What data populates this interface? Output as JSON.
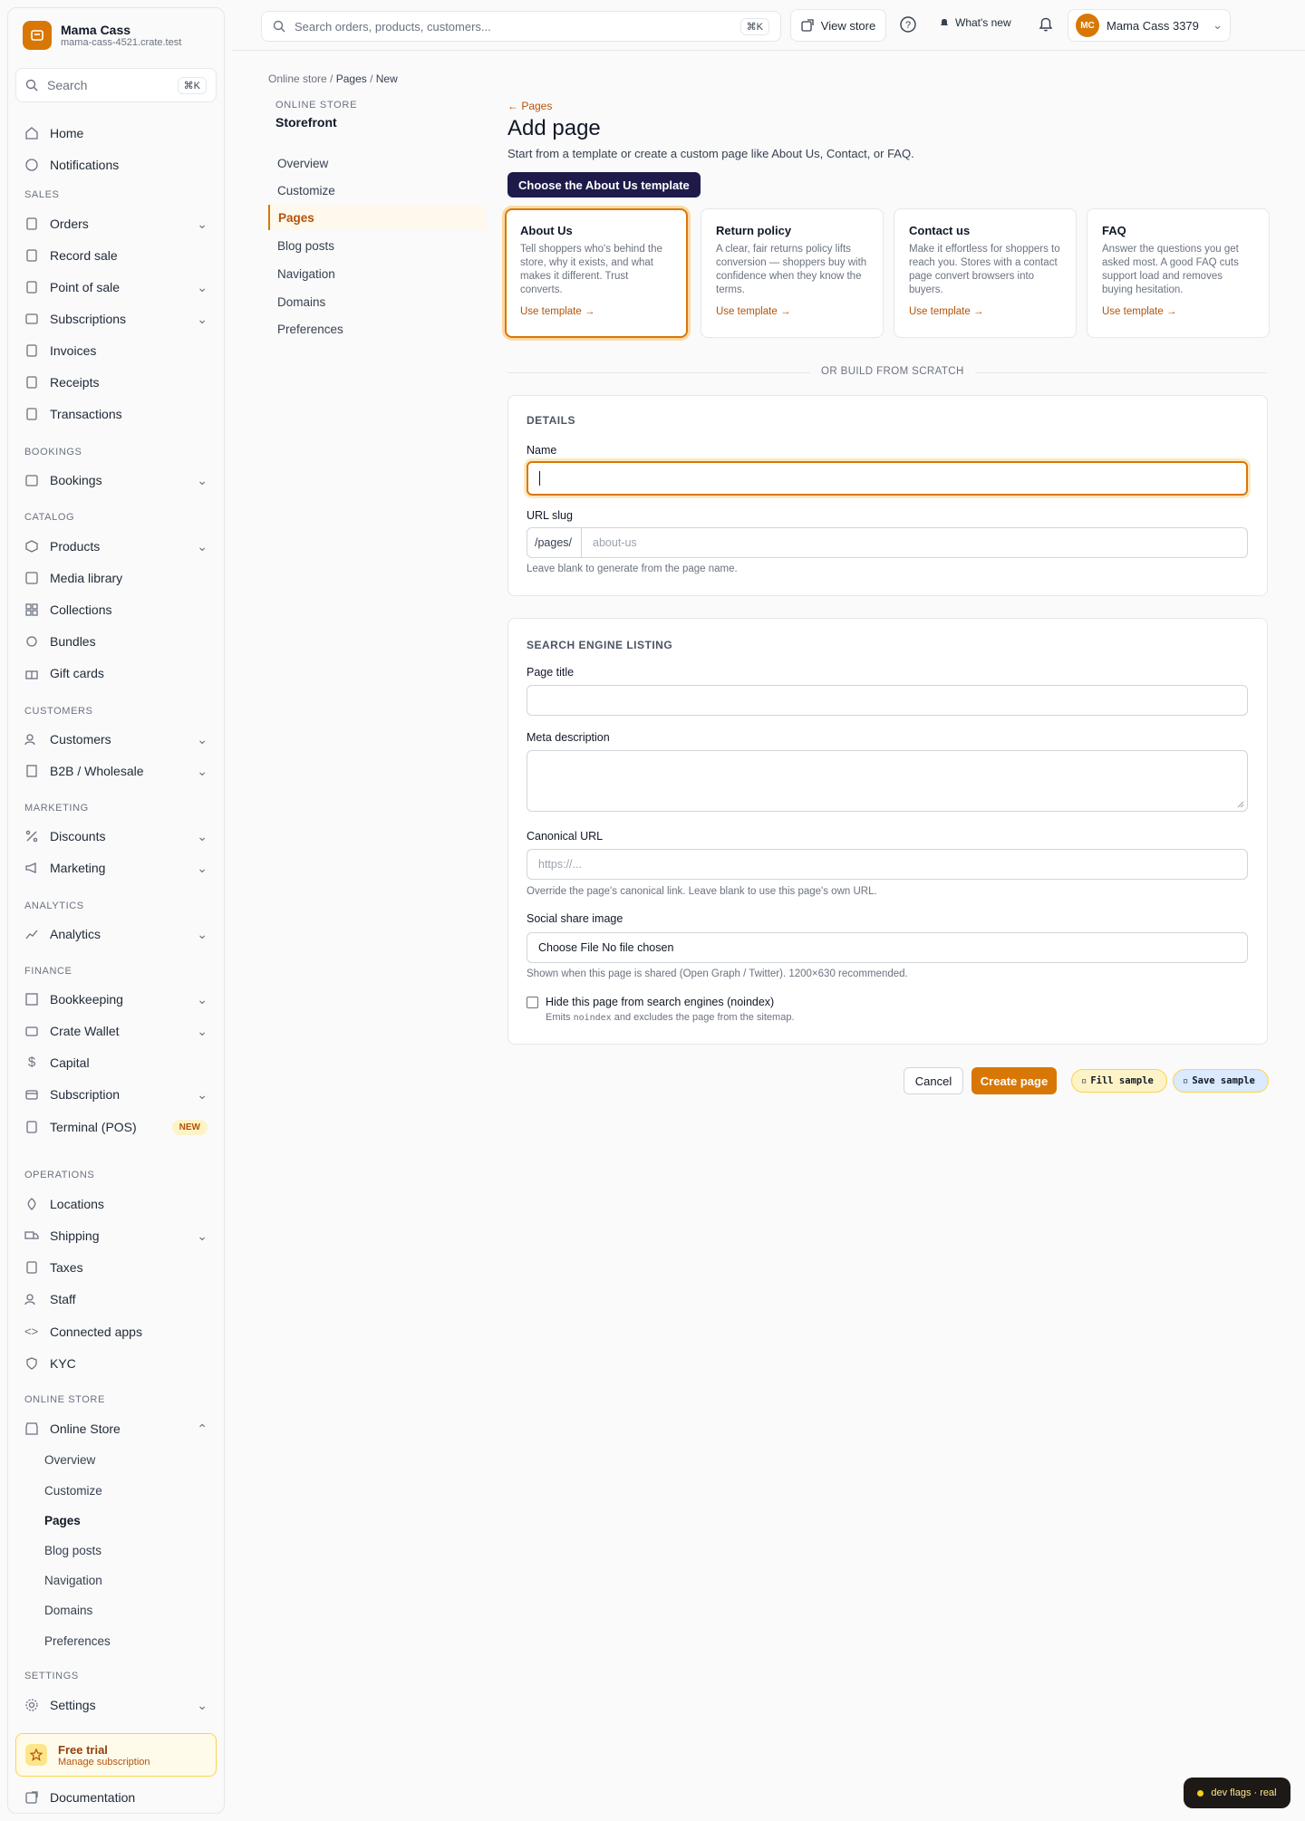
{
  "store": {
    "name": "Mama Cass",
    "domain": "mama-cass-4521.crate.test"
  },
  "sidebar": {
    "search": {
      "placeholder": "Search",
      "shortcut": "⌘K"
    },
    "nav": {
      "home": "Home",
      "notifications": "Notifications",
      "sales_section": "SALES",
      "orders": "Orders",
      "record_sale": "Record sale",
      "point_of_sale": "Point of sale",
      "subscriptions": "Subscriptions",
      "invoices": "Invoices",
      "receipts": "Receipts",
      "transactions": "Transactions",
      "bookings_section": "BOOKINGS",
      "bookings": "Bookings",
      "catalog_section": "CATALOG",
      "products": "Products",
      "media_library": "Media library",
      "collections": "Collections",
      "bundles": "Bundles",
      "gift_cards": "Gift cards",
      "customers_section": "CUSTOMERS",
      "customers": "Customers",
      "b2b": "B2B / Wholesale",
      "marketing_section": "MARKETING",
      "discounts": "Discounts",
      "marketing": "Marketing",
      "analytics_section": "ANALYTICS",
      "analytics": "Analytics",
      "finance_section": "FINANCE",
      "bookkeeping": "Bookkeeping",
      "crate_wallet": "Crate Wallet",
      "capital": "Capital",
      "subscription": "Subscription",
      "terminal": "Terminal (POS)",
      "terminal_badge": "NEW",
      "operations_section": "OPERATIONS",
      "locations": "Locations",
      "shipping": "Shipping",
      "taxes": "Taxes",
      "staff": "Staff",
      "connected_apps": "Connected apps",
      "kyc": "KYC",
      "online_store_section": "ONLINE STORE",
      "online_store": "Online Store",
      "os_overview": "Overview",
      "os_customize": "Customize",
      "os_pages": "Pages",
      "os_blog": "Blog posts",
      "os_navigation": "Navigation",
      "os_domains": "Domains",
      "os_preferences": "Preferences",
      "settings_section": "SETTINGS",
      "settings": "Settings"
    },
    "trial": {
      "title": "Free trial",
      "subtitle": "Manage subscription"
    },
    "documentation": "Documentation"
  },
  "topbar": {
    "search_placeholder": "Search orders, products, customers...",
    "search_shortcut": "⌘K",
    "view_store": "View store",
    "whats_new": "What's new",
    "account_initials": "MC",
    "account_name": "Mama Cass 3379"
  },
  "breadcrumb": {
    "root": "Online store",
    "mid": "Pages",
    "current": "New"
  },
  "subnav": {
    "label": "ONLINE STORE",
    "title": "Storefront",
    "items": [
      "Overview",
      "Customize",
      "Pages",
      "Blog posts",
      "Navigation",
      "Domains",
      "Preferences"
    ]
  },
  "main": {
    "back_link": "← Pages",
    "title": "Add page",
    "subtitle": "Start from a template or create a custom page like About Us, Contact, or FAQ.",
    "tooltip": "Choose the About Us template",
    "templates": [
      {
        "title": "About Us",
        "desc": "Tell shoppers who's behind the store, why it exists, and what makes it different. Trust converts.",
        "link": "Use template →"
      },
      {
        "title": "Return policy",
        "desc": "A clear, fair returns policy lifts conversion — shoppers buy with confidence when they know the terms.",
        "link": "Use template →"
      },
      {
        "title": "Contact us",
        "desc": "Make it effortless for shoppers to reach you. Stores with a contact page convert browsers into buyers.",
        "link": "Use template →"
      },
      {
        "title": "FAQ",
        "desc": "Answer the questions you get asked most. A good FAQ cuts support load and removes buying hesitation.",
        "link": "Use template →"
      }
    ],
    "divider": "OR BUILD FROM SCRATCH",
    "details": {
      "heading": "DETAILS",
      "name_label": "Name",
      "name_value": "",
      "slug_label": "URL slug",
      "slug_prefix": "/pages/",
      "slug_placeholder": "about-us",
      "slug_help": "Leave blank to generate from the page name."
    },
    "seo": {
      "heading": "SEARCH ENGINE LISTING",
      "page_title_label": "Page title",
      "meta_label": "Meta description",
      "canonical_label": "Canonical URL",
      "canonical_placeholder": "https://...",
      "canonical_help": "Override the page's canonical link. Leave blank to use this page's own URL.",
      "image_label": "Social share image",
      "image_button": "Choose File",
      "image_status": "No file chosen",
      "image_help": "Shown when this page is shared (Open Graph / Twitter). 1200×630 recommended.",
      "noindex_label": "Hide this page from search engines (noindex)",
      "noindex_help_pre": "Emits ",
      "noindex_help_code": "noindex",
      "noindex_help_post": " and excludes the page from the sitemap."
    },
    "actions": {
      "cancel": "Cancel",
      "create": "Create page",
      "fill": "Fill sample",
      "save": "Save sample"
    }
  },
  "dev_flags": "dev flags · real",
  "colors": {
    "accent": "#d97706",
    "accent_text": "#b45309",
    "tooltip_bg": "#1e1b4b"
  }
}
